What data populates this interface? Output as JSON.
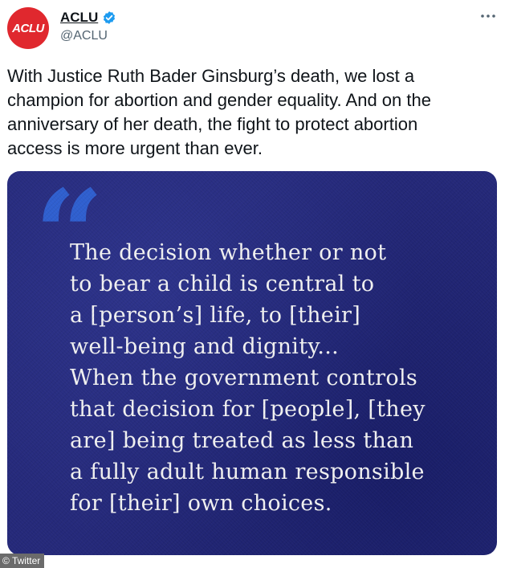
{
  "account": {
    "display_name": "ACLU",
    "handle": "@ACLU",
    "avatar_text": "ACLU",
    "verified": true
  },
  "tweet": {
    "text": "With Justice Ruth Bader Ginsburg’s death, we lost a\nchampion for abortion and gender equality. And on the\nanniversary of her death, the fight to protect abortion\naccess is more urgent than ever."
  },
  "media": {
    "quote_mark": "“",
    "quote": "The decision whether or not\nto bear a child is central to\na [person’s] life, to [their]\nwell-being and dignity...\nWhen the government controls\nthat decision for [people], [they\nare] being treated as less than\na fully adult human responsible\nfor [their] own choices."
  },
  "watermark": {
    "text": "© Twitter"
  },
  "icons": {
    "more": "more-horizontal-icon",
    "verified": "verified-badge-icon"
  },
  "colors": {
    "avatar_red": "#e0282e",
    "verified_blue": "#1d9bf0",
    "media_navy": "#25297a",
    "quote_mark_blue": "#2f5fcf",
    "text_primary": "#0f1419",
    "text_secondary": "#536471"
  }
}
